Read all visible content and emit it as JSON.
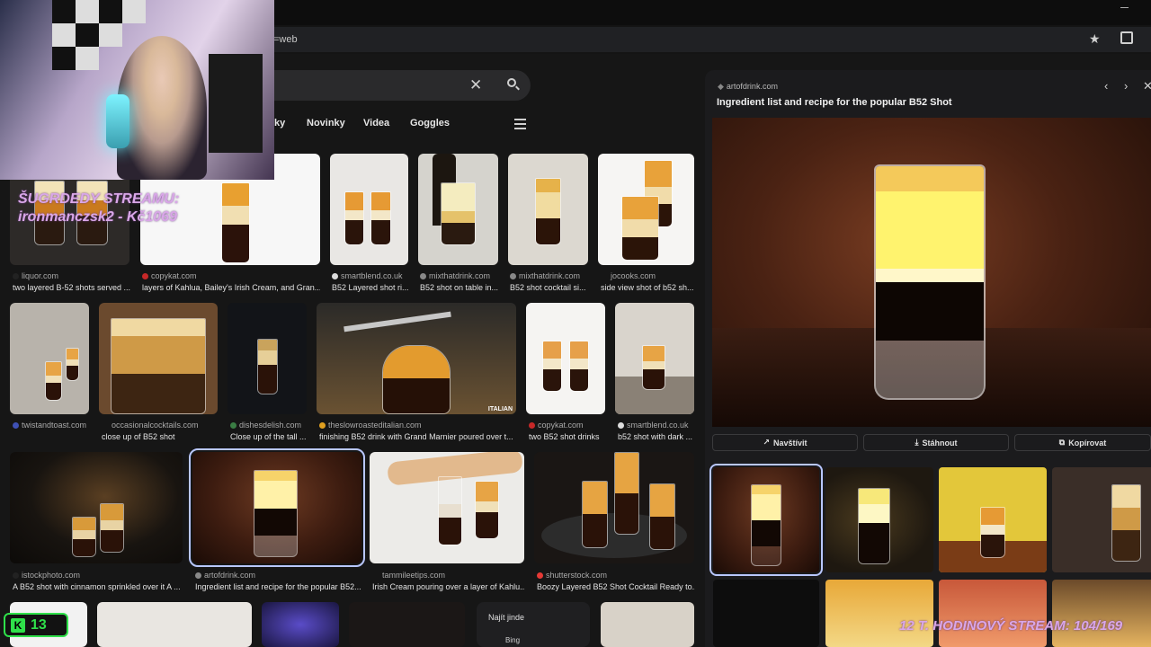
{
  "browser": {
    "url_fragment": "=web",
    "star_icon": "star-icon",
    "extensions_icon": "puzzle-icon"
  },
  "search": {
    "clear_icon": "close-icon",
    "search_icon": "search-icon"
  },
  "tabs": [
    {
      "label": "ky"
    },
    {
      "label": "Novinky"
    },
    {
      "label": "Videa"
    },
    {
      "label": "Goggles"
    }
  ],
  "results": [
    {
      "source": "liquor.com",
      "caption": "two layered B-52 shots served ..."
    },
    {
      "source": "copykat.com",
      "caption": "layers of Kahlua, Bailey's Irish Cream, and Gran..."
    },
    {
      "source": "smartblend.co.uk",
      "caption": "B52 Layered shot ri..."
    },
    {
      "source": "mixthatdrink.com",
      "caption": "B52 shot on table in..."
    },
    {
      "source": "mixthatdrink.com",
      "caption": "B52 shot cocktail si..."
    },
    {
      "source": "jocooks.com",
      "caption": "side view shot of b52 sh..."
    },
    {
      "source": "twistandtoast.com",
      "caption": ""
    },
    {
      "source": "occasionalcocktails.com",
      "caption": "close up of B52 shot"
    },
    {
      "source": "dishesdelish.com",
      "caption": "Close up of the tall ..."
    },
    {
      "source": "theslowroasteditalian.com",
      "caption": "finishing B52 drink with Grand Marnier poured over t..."
    },
    {
      "source": "copykat.com",
      "caption": "two B52 shot drinks"
    },
    {
      "source": "smartblend.co.uk",
      "caption": "b52 shot with dark ..."
    },
    {
      "source": "istockphoto.com",
      "caption": "A B52 shot with cinnamon sprinkled over it A ..."
    },
    {
      "source": "artofdrink.com",
      "caption": "Ingredient list and recipe for the popular B52..."
    },
    {
      "source": "tammileetips.com",
      "caption": "Irish Cream pouring over a layer of Kahlu..."
    },
    {
      "source": "shutterstock.com",
      "caption": "Boozy Layered B52 Shot Cocktail Ready to..."
    }
  ],
  "image_labels": {
    "italian": "ITALIAN"
  },
  "panel": {
    "source": "artofdrink.com",
    "title": "Ingredient list and recipe for the popular B52 Shot",
    "visit_label": "Navštívit",
    "download_label": "Stáhnout",
    "copy_label": "Kopírovat",
    "prev_icon": "chevron-left-icon",
    "next_icon": "chevron-right-icon",
    "close_icon": "close-icon"
  },
  "find_elsewhere": {
    "label": "Najít jinde",
    "bing": "Bing"
  },
  "overlays": {
    "donor_line1": "ŠUGRDEDY STREAMU:",
    "donor_line2": "ironmanczsk2 - Kč1069",
    "kick_count": "13",
    "stream_text": "12 T. HODINOVÝ STREAM: 104/169"
  },
  "colors": {
    "accent_selected": "#b9c7ff",
    "kick_green": "#2fe04a",
    "overlay_pink": "#d9a7e8"
  }
}
